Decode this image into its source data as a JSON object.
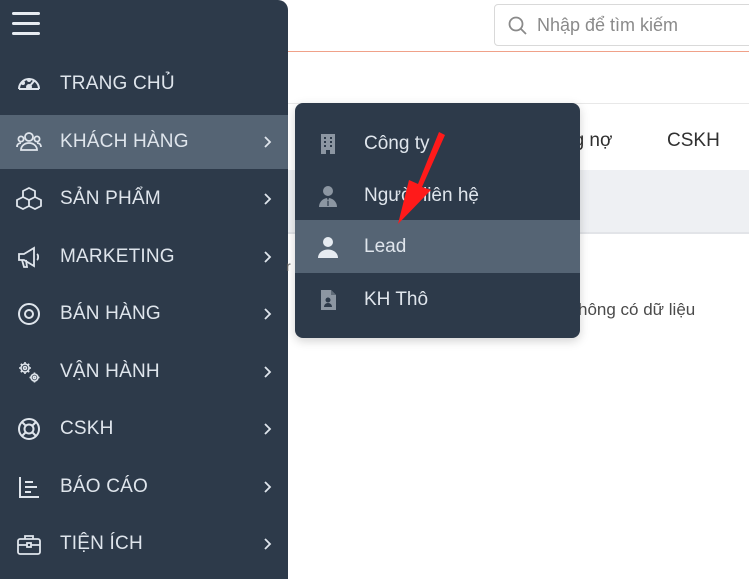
{
  "header": {
    "search_placeholder": "Nhập để tìm kiếm"
  },
  "sidebar": {
    "items": [
      {
        "label": "TRANG CHỦ",
        "icon": "dashboard-icon",
        "has_submenu": false
      },
      {
        "label": "KHÁCH HÀNG",
        "icon": "customers-icon",
        "has_submenu": true,
        "active": true
      },
      {
        "label": "SẢN PHẨM",
        "icon": "products-icon",
        "has_submenu": true
      },
      {
        "label": "MARKETING",
        "icon": "megaphone-icon",
        "has_submenu": true
      },
      {
        "label": "BÁN HÀNG",
        "icon": "target-icon",
        "has_submenu": true
      },
      {
        "label": "VẬN HÀNH",
        "icon": "gears-icon",
        "has_submenu": true
      },
      {
        "label": "CSKH",
        "icon": "lifebuoy-icon",
        "has_submenu": true
      },
      {
        "label": "BÁO CÁO",
        "icon": "report-icon",
        "has_submenu": true
      },
      {
        "label": "TIỆN ÍCH",
        "icon": "toolbox-icon",
        "has_submenu": true
      }
    ]
  },
  "submenu": {
    "items": [
      {
        "label": "Công ty",
        "icon": "building-icon"
      },
      {
        "label": "Người liên hệ",
        "icon": "contact-person-icon"
      },
      {
        "label": "Lead",
        "icon": "user-icon",
        "active": true
      },
      {
        "label": "KH Thô",
        "icon": "raw-customer-file-icon"
      }
    ]
  },
  "content": {
    "tabs": [
      "Công nợ",
      "CSKH"
    ],
    "tab_partial_visible": "ng nợ",
    "empty_message": "Không có dữ liệu",
    "empty_message_visible": "hông có dữ liệu",
    "stray_char": "r"
  },
  "colors": {
    "sidebar_bg": "#2d3a4a",
    "active_bg": "#556474",
    "text_light": "#dfe5ec",
    "accent_line": "#f0a189",
    "arrow_red": "#ff1a1a"
  }
}
